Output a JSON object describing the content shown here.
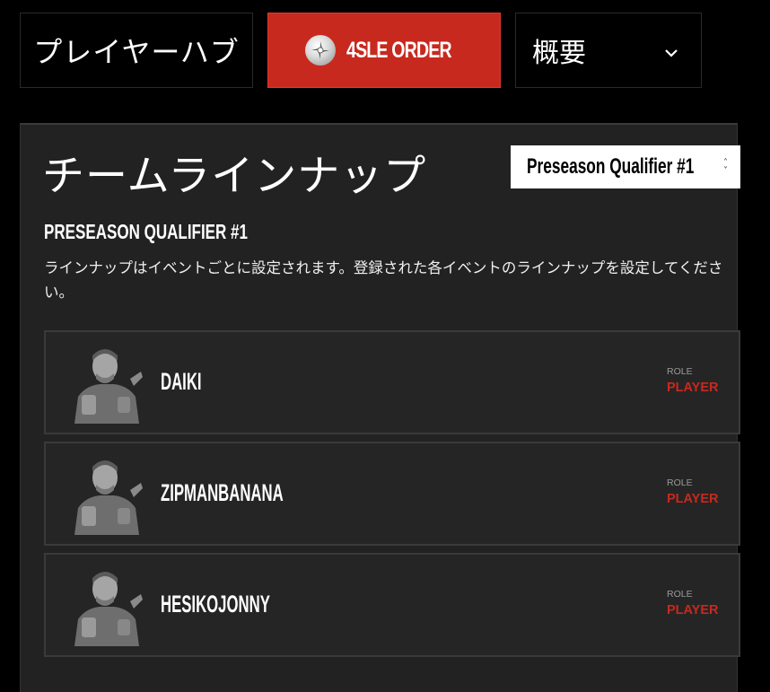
{
  "nav": {
    "hub_label": "プレイヤーハブ",
    "team_name": "4SLE ORDER",
    "menu_label": "概要",
    "accent_color": "#c8291f"
  },
  "panel": {
    "title": "チームラインナップ",
    "event_select": {
      "selected": "Preseason Qualifier #1"
    },
    "section_heading": "PRESEASON QUALIFIER #1",
    "description": "ラインナップはイベントごとに設定されます。登録された各イベントのラインナップを設定してください。"
  },
  "players": [
    {
      "name": "DAIKI",
      "role_label": "ROLE",
      "role": "PLAYER"
    },
    {
      "name": "ZIPMANBANANA",
      "role_label": "ROLE",
      "role": "PLAYER"
    },
    {
      "name": "HESIKOJONNY",
      "role_label": "ROLE",
      "role": "PLAYER"
    }
  ]
}
